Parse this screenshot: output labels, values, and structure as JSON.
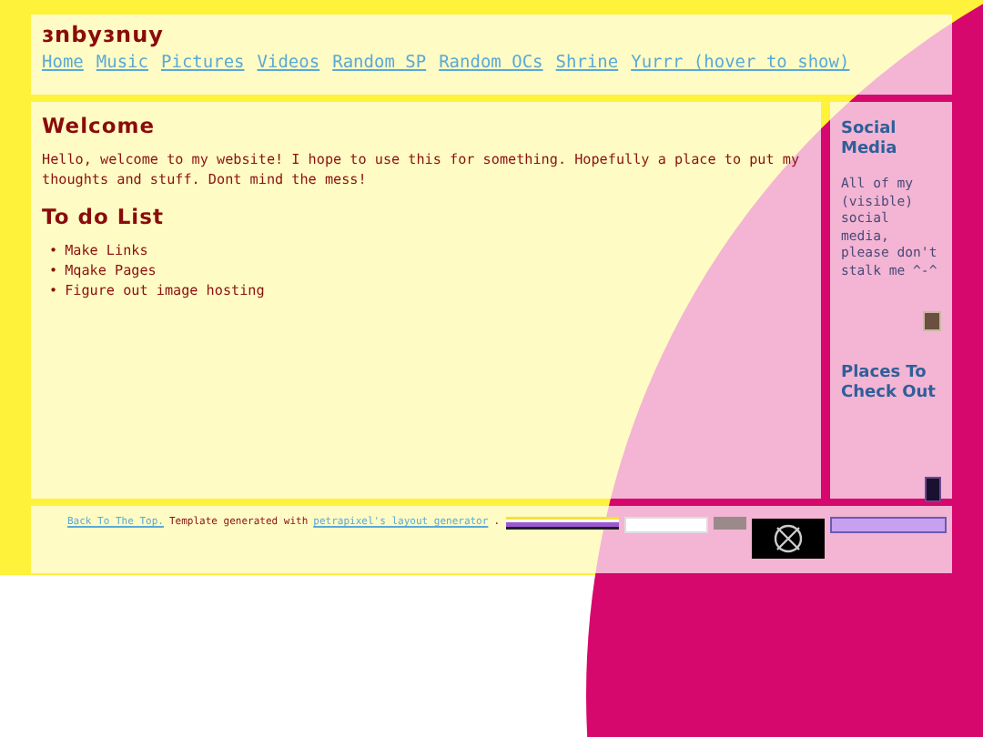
{
  "header": {
    "title": "ɜnbyɜnuy",
    "nav": [
      "Home",
      "Music",
      "Pictures",
      "Videos",
      "Random SP",
      "Random OCs",
      "Shrine",
      "Yurrr (hover to show)"
    ]
  },
  "main": {
    "heading": "Welcome",
    "intro": "Hello, welcome to my website! I hope to use this for something. Hopefully a place to put my thoughts and stuff. Dont mind the mess!",
    "todo_heading": "To do List",
    "bullet": "•",
    "todo": [
      "Make Links",
      "Mqake Pages",
      "Figure out image hosting"
    ]
  },
  "sidebar": {
    "sections": [
      {
        "heading": "Social Media",
        "text": "All of my (visible) social media, please don't stalk me ^-^"
      },
      {
        "heading": "Places To Check Out"
      }
    ]
  },
  "footer": {
    "back_link": "Back To The Top.",
    "credit": "Template generated with",
    "generator_link": "petrapixel's layout generator",
    "after": "."
  }
}
